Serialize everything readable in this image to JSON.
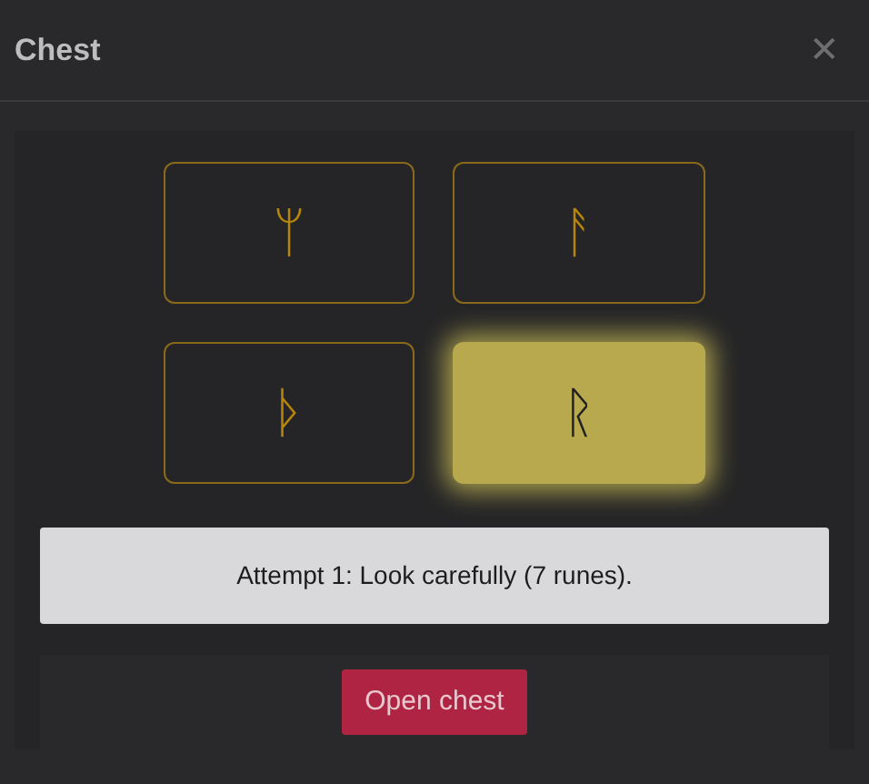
{
  "window": {
    "title": "Chest",
    "close": "✕"
  },
  "runes": [
    {
      "glyph": "ᛘ",
      "selected": false
    },
    {
      "glyph": "ᚨ",
      "selected": false
    },
    {
      "glyph": "ᚦ",
      "selected": false
    },
    {
      "glyph": "ᚱ",
      "selected": true
    }
  ],
  "message": "Attempt 1: Look carefully (7 runes).",
  "button": "Open chest"
}
